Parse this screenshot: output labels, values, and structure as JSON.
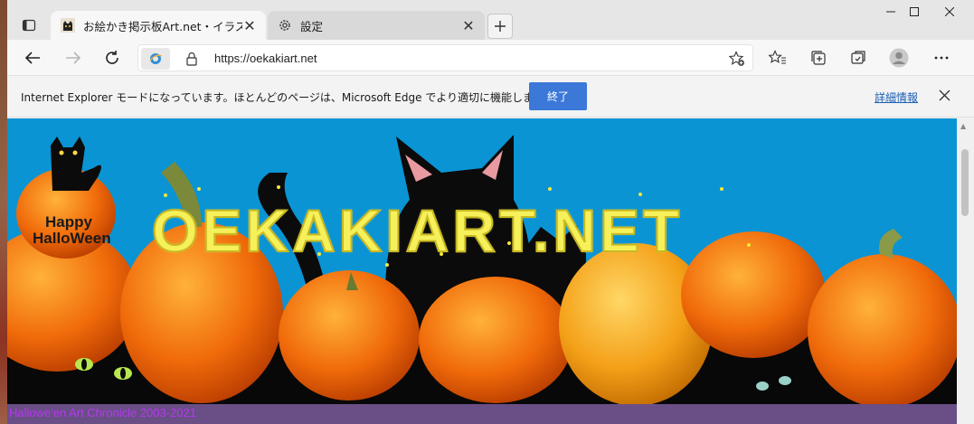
{
  "browser": {
    "tabs": [
      {
        "title": "お絵かき掲示板Art.net・イラスト投稿",
        "active": true
      },
      {
        "title": "設定",
        "active": false
      }
    ],
    "address_url": "https://oekakiart.net"
  },
  "infobar": {
    "message": "Internet Explorer モードになっています。ほとんどのページは、Microsoft Edge でより適切に機能します。",
    "button_label": "終了",
    "link_label": "詳細情報"
  },
  "page": {
    "logo_text": "OEKAKIART.NET",
    "badge_line1": "Happy",
    "badge_line2": "HalloWeen",
    "caption": "Hallowe'en Art Chronicle  2003-2021"
  },
  "colors": {
    "accent": "#3b78d8",
    "sky": "#0a94d4",
    "pumpkin": "#f07a10",
    "caption_bar": "#6a4e86",
    "caption_text": "#b637f0"
  }
}
